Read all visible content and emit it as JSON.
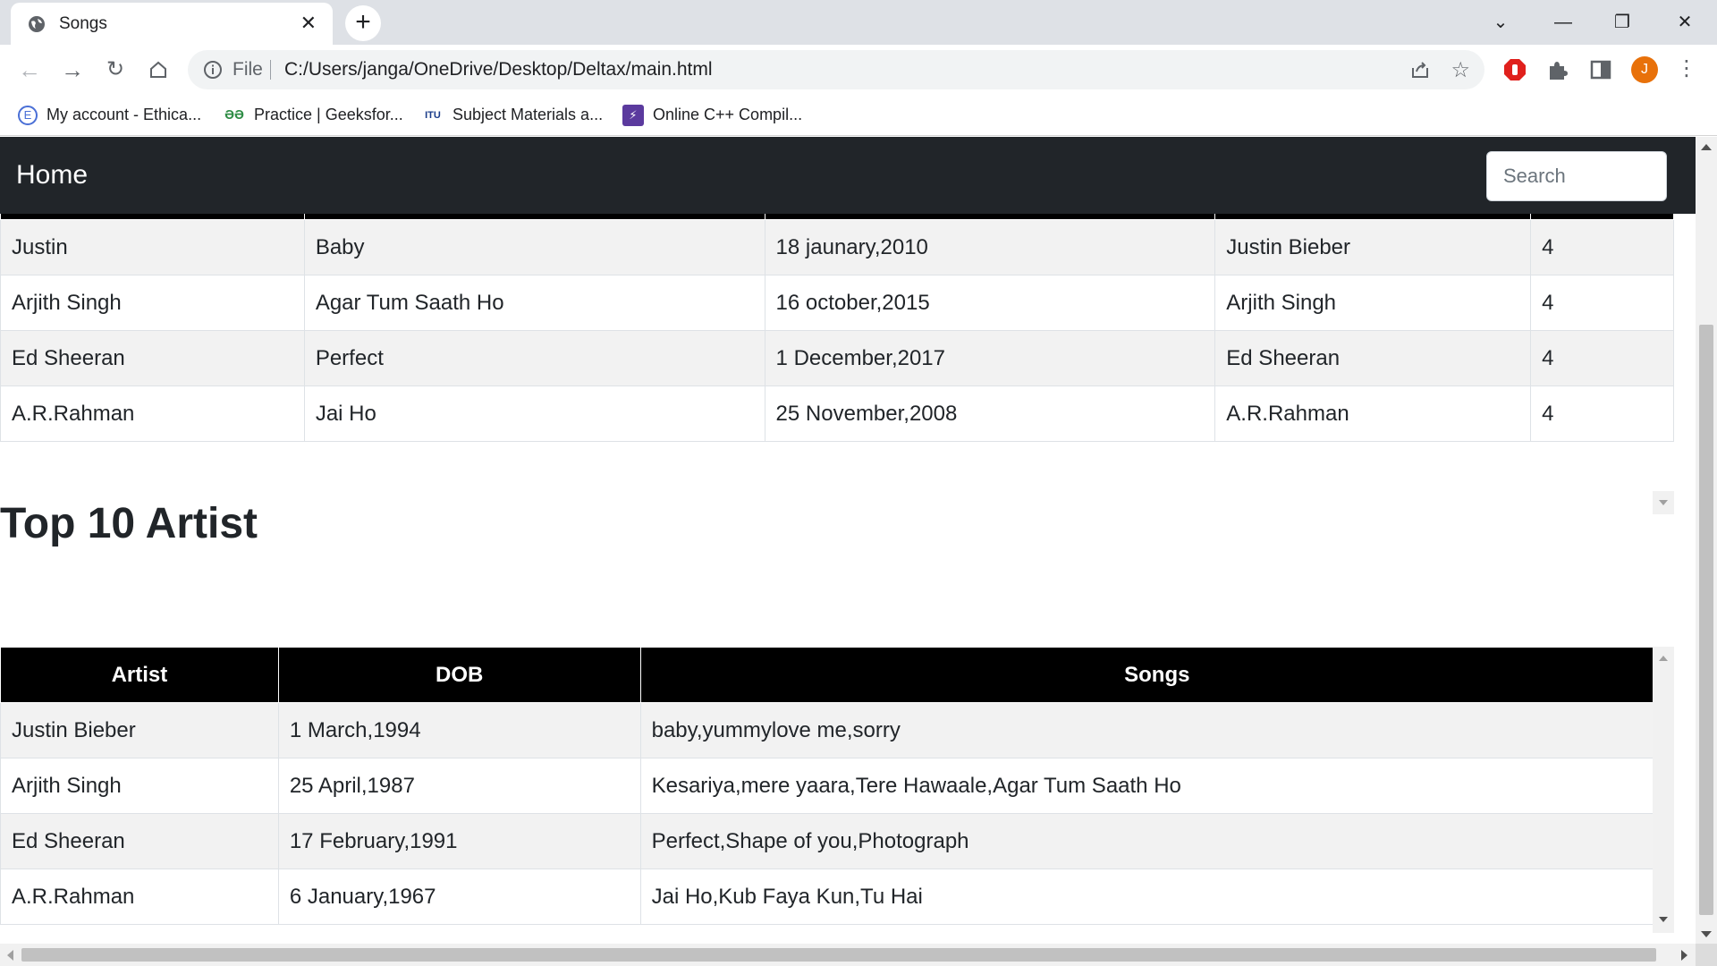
{
  "browser": {
    "tab_title": "Songs",
    "address_scheme": "File",
    "address_url": "C:/Users/janga/OneDrive/Desktop/Deltax/main.html",
    "avatar_letter": "J",
    "bookmarks": [
      {
        "label": "My account - Ethica...",
        "icon": "ethica-icon"
      },
      {
        "label": "Practice | Geeksfor...",
        "icon": "geeksforgeeks-icon"
      },
      {
        "label": "Subject Materials a...",
        "icon": "university-icon"
      },
      {
        "label": "Online C++ Compil...",
        "icon": "compiler-icon"
      }
    ]
  },
  "navbar": {
    "brand": "Home",
    "search_placeholder": "Search"
  },
  "songs_table": {
    "rows": [
      [
        "Justin",
        "Baby",
        "18 jaunary,2010",
        "Justin Bieber",
        "4"
      ],
      [
        "Arjith Singh",
        "Agar Tum Saath Ho",
        "16 october,2015",
        "Arjith Singh",
        "4"
      ],
      [
        "Ed Sheeran",
        "Perfect",
        "1 December,2017",
        "Ed Sheeran",
        "4"
      ],
      [
        "A.R.Rahman",
        "Jai Ho",
        "25 November,2008",
        "A.R.Rahman",
        "4"
      ]
    ]
  },
  "artists_section": {
    "heading": "Top 10 Artist",
    "headers": [
      "Artist",
      "DOB",
      "Songs"
    ],
    "rows": [
      [
        "Justin Bieber",
        "1 March,1994",
        "baby,yummylove me,sorry"
      ],
      [
        "Arjith Singh",
        "25 April,1987",
        "Kesariya,mere yaara,Tere Hawaale,Agar Tum Saath Ho"
      ],
      [
        "Ed Sheeran",
        "17 February,1991",
        "Perfect,Shape of you,Photograph"
      ],
      [
        "A.R.Rahman",
        "6 January,1967",
        "Jai Ho,Kub Faya Kun,Tu Hai"
      ]
    ]
  },
  "colors": {
    "navbar_bg": "#212529",
    "table_header_bg": "#000000",
    "striped_row_bg": "#f2f2f2",
    "avatar_bg": "#e8710a"
  }
}
